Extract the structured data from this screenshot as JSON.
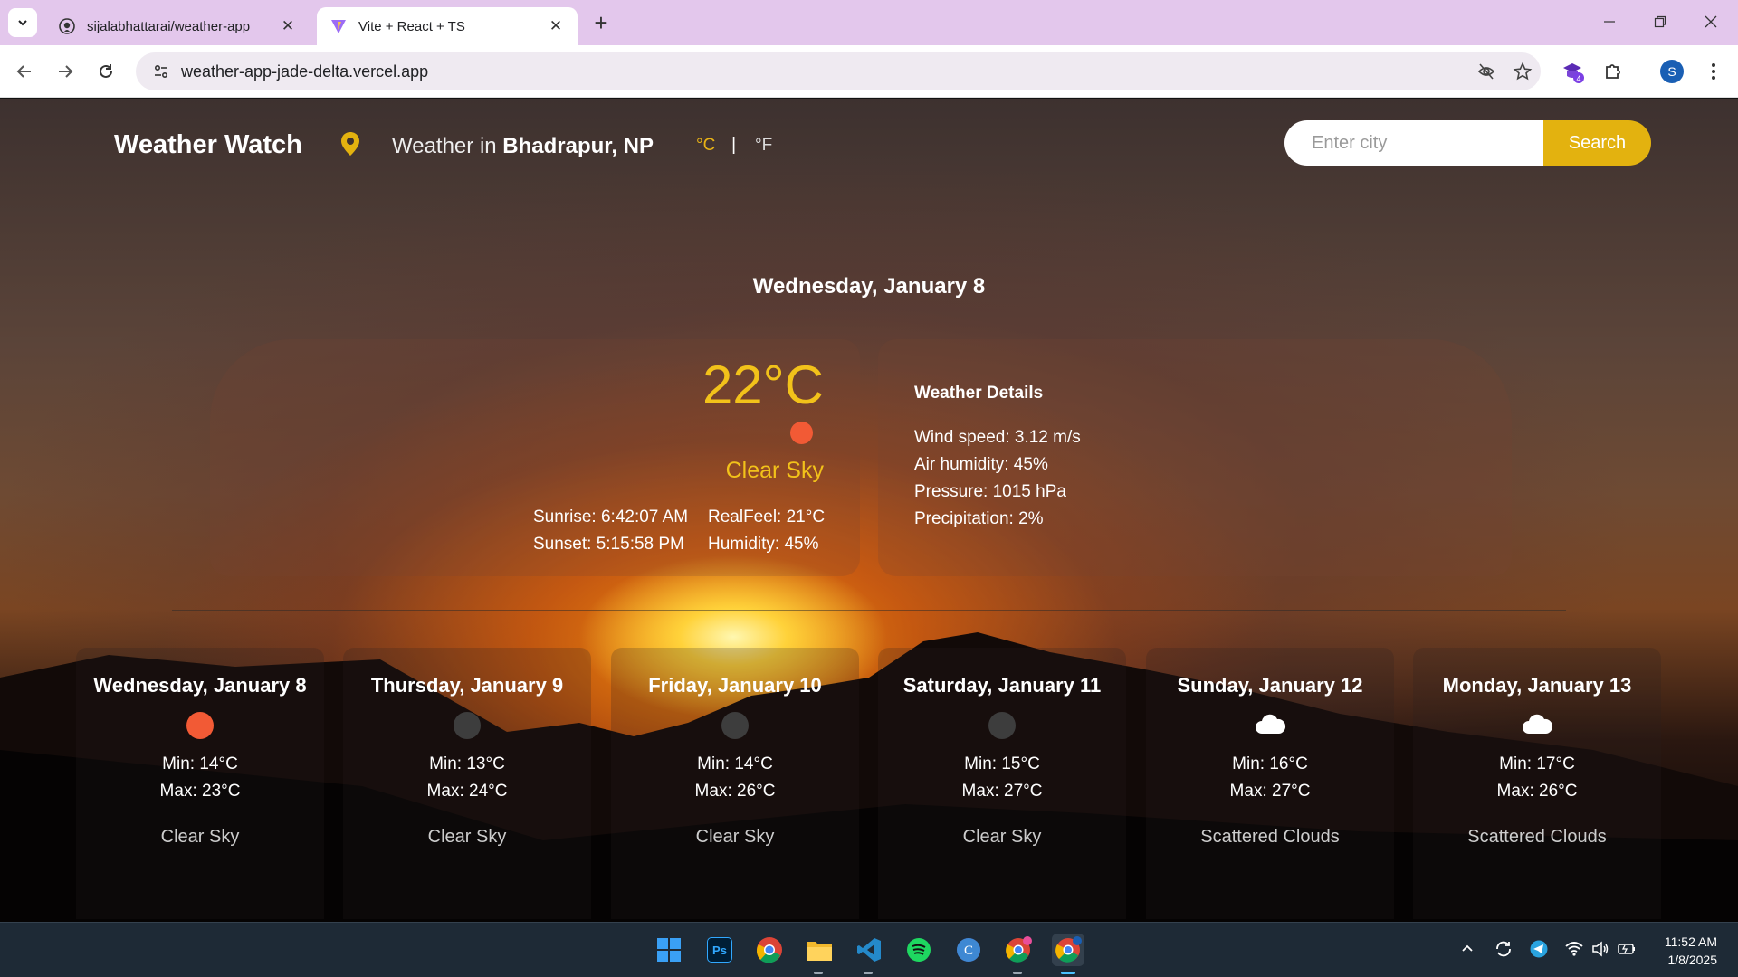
{
  "browser": {
    "tabs": [
      {
        "title": "sijalabhattarai/weather-app",
        "active": false
      },
      {
        "title": "Vite + React + TS",
        "active": true
      }
    ],
    "url": "weather-app-jade-delta.vercel.app",
    "profile_initial": "S",
    "extension_badge": "4"
  },
  "header": {
    "brand": "Weather Watch",
    "location_prefix": "Weather in",
    "location": "Bhadrapur, NP",
    "unit_c": "°C",
    "unit_separator": "|",
    "unit_f": "°F",
    "search_placeholder": "Enter city",
    "search_button": "Search"
  },
  "current": {
    "date": "Wednesday, January 8",
    "temperature": "22°C",
    "condition": "Clear Sky",
    "sunrise": "Sunrise: 6:42:07 AM",
    "sunset": "Sunset: 5:15:58 PM",
    "realfeel": "RealFeel: 21°C",
    "humidity": "Humidity: 45%"
  },
  "details": {
    "title": "Weather Details",
    "wind": "Wind speed: 3.12 m/s",
    "air_humidity": "Air humidity: 45%",
    "pressure": "Pressure: 1015 hPa",
    "precipitation": "Precipitation: 2%"
  },
  "forecast": [
    {
      "day": "Wednesday, January 8",
      "min": "Min: 14°C",
      "max": "Max: 23°C",
      "desc": "Clear Sky",
      "icon": "sun-icon",
      "color": "#f25a35"
    },
    {
      "day": "Thursday, January 9",
      "min": "Min: 13°C",
      "max": "Max: 24°C",
      "desc": "Clear Sky",
      "icon": "moon-icon",
      "color": "#3d3d3d"
    },
    {
      "day": "Friday, January 10",
      "min": "Min: 14°C",
      "max": "Max: 26°C",
      "desc": "Clear Sky",
      "icon": "moon-icon",
      "color": "#3d3d3d"
    },
    {
      "day": "Saturday, January 11",
      "min": "Min: 15°C",
      "max": "Max: 27°C",
      "desc": "Clear Sky",
      "icon": "moon-icon",
      "color": "#3d3d3d"
    },
    {
      "day": "Sunday, January 12",
      "min": "Min: 16°C",
      "max": "Max: 27°C",
      "desc": "Scattered Clouds",
      "icon": "cloud-icon",
      "color": "#ffffff"
    },
    {
      "day": "Monday, January 13",
      "min": "Min: 17°C",
      "max": "Max: 26°C",
      "desc": "Scattered Clouds",
      "icon": "cloud-icon",
      "color": "#ffffff"
    }
  ],
  "taskbar": {
    "time": "11:52 AM",
    "date": "1/8/2025"
  },
  "colors": {
    "accent": "#e3b20f",
    "temperature": "#f2c21a",
    "sun": "#f25a35",
    "tabstrip": "#e3c7ec",
    "taskbar": "#1e2a36"
  }
}
